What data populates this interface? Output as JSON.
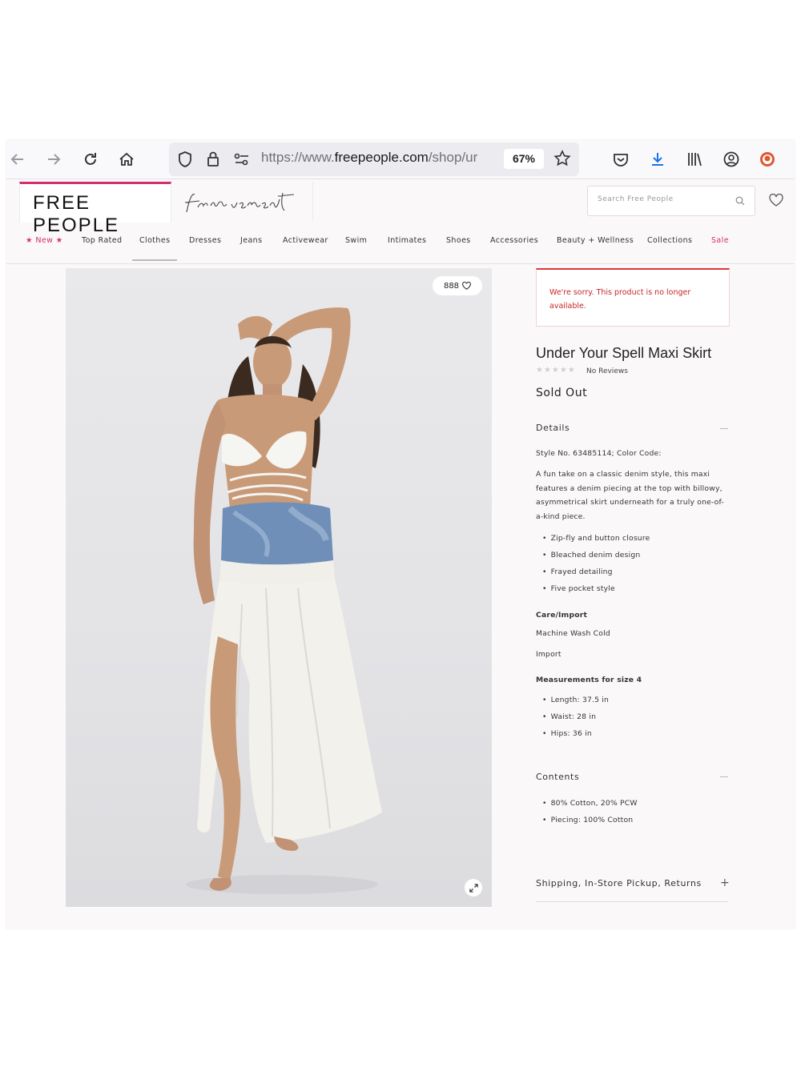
{
  "browser": {
    "url_prefix": "https://www.",
    "url_domain": "freepeople.com",
    "url_path": "/shop/ur",
    "zoom": "67%"
  },
  "site": {
    "logo": "FREE PEOPLE",
    "movement_logo": "fp movement",
    "search_placeholder": "Search Free People"
  },
  "nav": [
    "★ New ★",
    "Top Rated",
    "Clothes",
    "Dresses",
    "Jeans",
    "Activewear",
    "Swim",
    "Intimates",
    "Shoes",
    "Accessories",
    "Beauty + Wellness",
    "Collections",
    "Sale"
  ],
  "product": {
    "wishlist_count": "888",
    "alert": "We're sorry. This product is no longer available.",
    "title": "Under Your Spell Maxi Skirt",
    "stars": "★★★★★",
    "reviews": "No Reviews",
    "status": "Sold Out",
    "details_heading": "Details",
    "style_line": "Style No. 63485114; Color Code:",
    "description": "A fun take on a classic denim style, this maxi features a denim piecing at the top with billowy, asymmetrical skirt underneath for a truly one-of-a-kind piece.",
    "features": [
      "Zip-fly and button closure",
      "Bleached denim design",
      "Frayed detailing",
      "Five pocket style"
    ],
    "care_heading": "Care/Import",
    "care": [
      "Machine Wash Cold",
      "Import"
    ],
    "measure_heading": "Measurements for size 4",
    "measurements": [
      "Length: 37.5 in",
      "Waist: 28 in",
      "Hips: 36 in"
    ],
    "contents_heading": "Contents",
    "contents": [
      "80% Cotton, 20% PCW",
      "Piecing: 100% Cotton"
    ],
    "shipping_heading": "Shipping, In-Store Pickup, Returns"
  }
}
